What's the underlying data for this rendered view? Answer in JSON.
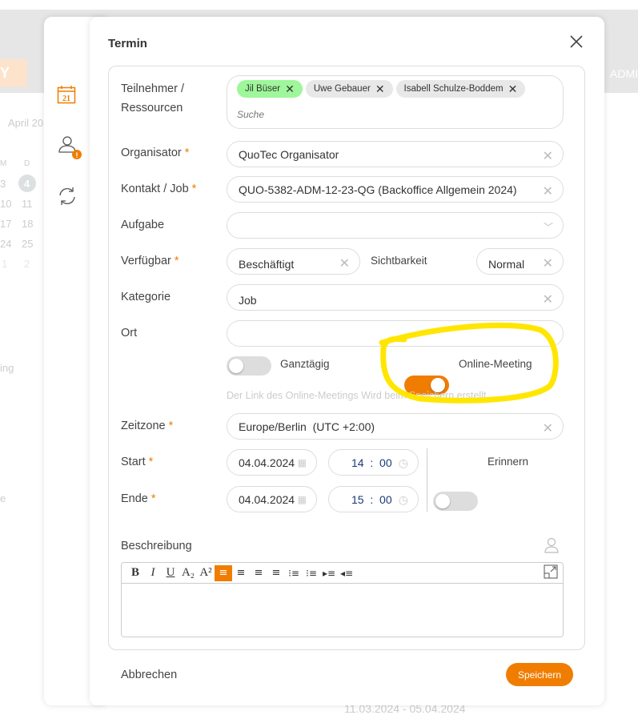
{
  "background": {
    "left_button": "Y",
    "admin": "ADMI",
    "month": "April 20",
    "weekdays": [
      "M",
      "D"
    ],
    "days": [
      [
        "3",
        "4"
      ],
      [
        "10",
        "11"
      ],
      [
        "17",
        "18"
      ],
      [
        "24",
        "25"
      ],
      [
        "1",
        "2"
      ]
    ],
    "side_text": "ing",
    "lower_text": "e",
    "date_range": "11.03.2024 - 05.04.2024"
  },
  "dialog": {
    "title": "Termin",
    "close_icon": "close-icon",
    "sidebar": [
      "calendar-icon",
      "user-warning-icon",
      "sync-icon"
    ],
    "calendar_day": "21",
    "fields": {
      "participants": {
        "label1": "Teilnehmer /",
        "label2": "Ressourcen",
        "chips": [
          "Jil Büser",
          "Uwe Gebauer",
          "Isabell Schulze-Boddem"
        ],
        "placeholder": "Suche"
      },
      "organizer": {
        "label": "Organisator",
        "value": "QuoTec Organisator"
      },
      "contact": {
        "label": "Kontakt / Job",
        "value": "QUO-5382-ADM-12-23-QG (Backoffice Allgemein 2024)"
      },
      "task": {
        "label": "Aufgabe",
        "value": ""
      },
      "available": {
        "label": "Verfügbar",
        "value": "Beschäftigt"
      },
      "visibility": {
        "label": "Sichtbarkeit",
        "value": "Normal"
      },
      "category": {
        "label": "Kategorie",
        "value": "Job"
      },
      "location": {
        "label": "Ort",
        "value": ""
      },
      "all_day": {
        "label": "Ganztägig",
        "on": false
      },
      "online_meeting": {
        "label": "Online-Meeting",
        "on": true
      },
      "hint": "Der Link des Online-Meetings Wird beim Speichern erstellt",
      "timezone": {
        "label": "Zeitzone",
        "value": "Europe/Berlin  (UTC +2:00)"
      },
      "start": {
        "label": "Start",
        "date": "04.04.2024",
        "hour": "14",
        "minute": "00"
      },
      "end": {
        "label": "Ende",
        "date": "04.04.2024",
        "hour": "15",
        "minute": "00"
      },
      "remind": {
        "label": "Erinnern",
        "on": false
      },
      "description": {
        "label": "Beschreibung",
        "toolbar": [
          "B",
          "I",
          "U",
          "A₂",
          "A²"
        ]
      }
    },
    "required_mark": "*",
    "cancel": "Abbrechen",
    "save": "Speichern",
    "colon": ":",
    "accent": "#f07d00",
    "highlight": "#ffe600"
  }
}
